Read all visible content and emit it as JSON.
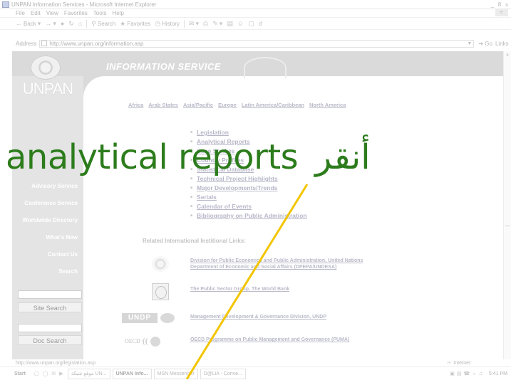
{
  "window": {
    "title": "UNPAN Information Services - Microsoft Internet Explorer",
    "controls": [
      "_",
      "8",
      "x"
    ]
  },
  "menubar": {
    "items": [
      "File",
      "Edit",
      "View",
      "Favorites",
      "Tools",
      "Help"
    ]
  },
  "toolbar": {
    "back": "Back",
    "search": "Search",
    "favorites": "Favorites",
    "history": "History"
  },
  "addressbar": {
    "label": "Address",
    "url": "http://www.unpan.org/information.asp",
    "go": "Go",
    "links": "Links"
  },
  "header": {
    "logo_text": "UNPAN",
    "section_title": "INFORMATION SERVICE"
  },
  "sidebar": {
    "items": [
      "",
      "",
      "",
      "",
      "Advisory Service",
      "Conference Service",
      "Worldwide Directory",
      "What's New",
      "Contact Us",
      "Search"
    ],
    "site_search_label": "Site Search",
    "doc_search_label": "Doc Search"
  },
  "regions": [
    "Africa",
    "Arab States",
    "Asia/Pacific",
    "Europe",
    "Latin America/Caribbean",
    "North America"
  ],
  "topics": [
    "Legislation",
    "Analytical Reports",
    "Case Studies",
    "Country Profiles",
    "Statistical Database",
    "Technical Project Highlights",
    "Major Developments/Trends",
    "Serials",
    "Calendar of Events",
    "Bibliography on Public Administration"
  ],
  "related": {
    "title": "Related International Institional Links:",
    "links": [
      {
        "line1": "Division for Public Economics and Public Administration, United Nations",
        "line2": "Department of Economic and Social Affairs (DPEPA/UNDESA)"
      },
      {
        "line1": "The Public Sector Group, The World Bank",
        "line2": ""
      },
      {
        "line1": "Management Development & Governance Division, UNDP",
        "line2": ""
      },
      {
        "line1": "OECD Programme on Public Management and Governance (PUMA)",
        "line2": ""
      }
    ],
    "undp_text": "UNDP",
    "oecd_text": "OECD"
  },
  "statusbar": {
    "url": "http://www.unpan.org/legislation.asp",
    "zone": "Internet"
  },
  "taskbar": {
    "start": "Start",
    "tasks": [
      "موقع شبكة UN...",
      "UNPAN Info...",
      "MSN Messenger",
      "D@LiA - Conve..."
    ],
    "clock": "5:41 PM"
  },
  "overlay": {
    "english": "analytical reports",
    "arabic": "أنقر"
  },
  "colors": {
    "caption": "#2c7c1c",
    "pointer": "#f2c500"
  }
}
